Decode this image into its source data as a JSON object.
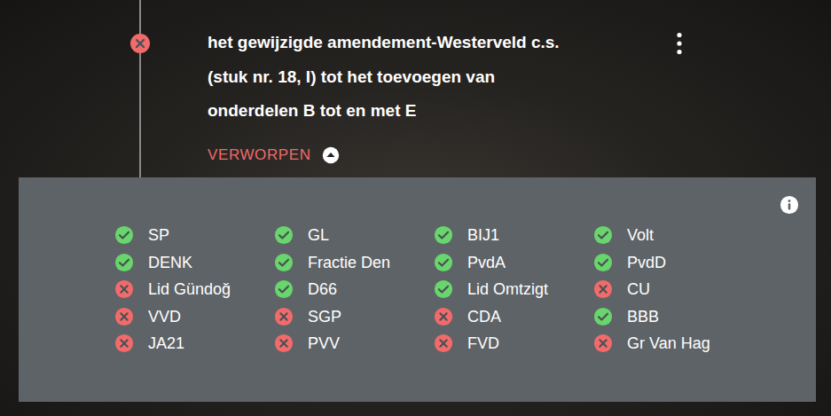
{
  "title_lines": [
    "het gewijzigde amendement-Westerveld c.s.",
    "(stuk nr. 18, I) tot het toevoegen van",
    "onderdelen B tot en met E"
  ],
  "result": {
    "label": "VERWORPEN",
    "accepted": false,
    "expanded": true
  },
  "votes": [
    {
      "party": "SP",
      "for": true
    },
    {
      "party": "GL",
      "for": true
    },
    {
      "party": "BIJ1",
      "for": true
    },
    {
      "party": "Volt",
      "for": true
    },
    {
      "party": "DENK",
      "for": true
    },
    {
      "party": "Fractie Den",
      "for": true
    },
    {
      "party": "PvdA",
      "for": true
    },
    {
      "party": "PvdD",
      "for": true
    },
    {
      "party": "Lid Gündoğ",
      "for": false
    },
    {
      "party": "D66",
      "for": true
    },
    {
      "party": "Lid Omtzigt",
      "for": true
    },
    {
      "party": "CU",
      "for": false
    },
    {
      "party": "VVD",
      "for": false
    },
    {
      "party": "SGP",
      "for": false
    },
    {
      "party": "CDA",
      "for": false
    },
    {
      "party": "BBB",
      "for": true
    },
    {
      "party": "JA21",
      "for": false
    },
    {
      "party": "PVV",
      "for": false
    },
    {
      "party": "FVD",
      "for": false
    },
    {
      "party": "Gr Van Hag",
      "for": false
    }
  ]
}
